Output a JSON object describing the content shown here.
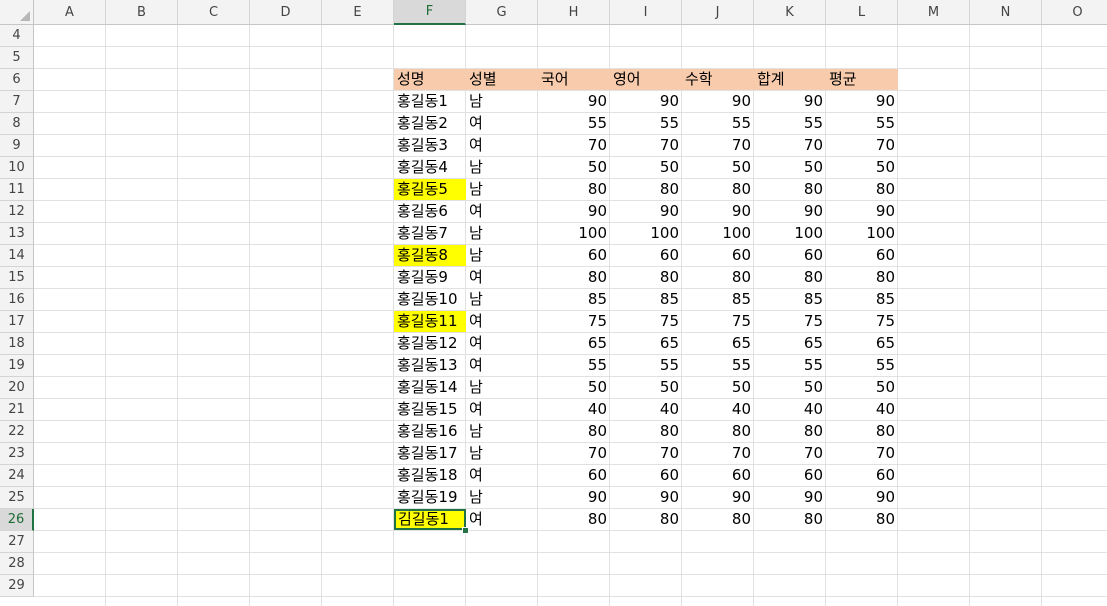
{
  "sheet": {
    "columns": [
      "A",
      "B",
      "C",
      "D",
      "E",
      "F",
      "G",
      "H",
      "I",
      "J",
      "K",
      "L",
      "M",
      "N",
      "O"
    ],
    "active_column": "F",
    "rows": [
      4,
      5,
      6,
      7,
      8,
      9,
      10,
      11,
      12,
      13,
      14,
      15,
      16,
      17,
      18,
      19,
      20,
      21,
      22,
      23,
      24,
      25,
      26,
      27,
      28,
      29
    ],
    "active_row": 26,
    "header_fill_color": "#f8cbad",
    "highlight_color": "#ffff00",
    "selection_color": "#217346"
  },
  "table": {
    "headers": [
      "성명",
      "성별",
      "국어",
      "영어",
      "수학",
      "합계",
      "평균"
    ],
    "records": [
      {
        "name": "홍길동1",
        "gender": "남",
        "kor": "90",
        "eng": "90",
        "math": "90",
        "total": "90",
        "avg": "90",
        "highlight": false
      },
      {
        "name": "홍길동2",
        "gender": "여",
        "kor": "55",
        "eng": "55",
        "math": "55",
        "total": "55",
        "avg": "55",
        "highlight": false
      },
      {
        "name": "홍길동3",
        "gender": "여",
        "kor": "70",
        "eng": "70",
        "math": "70",
        "total": "70",
        "avg": "70",
        "highlight": false
      },
      {
        "name": "홍길동4",
        "gender": "남",
        "kor": "50",
        "eng": "50",
        "math": "50",
        "total": "50",
        "avg": "50",
        "highlight": false
      },
      {
        "name": "홍길동5",
        "gender": "남",
        "kor": "80",
        "eng": "80",
        "math": "80",
        "total": "80",
        "avg": "80",
        "highlight": true
      },
      {
        "name": "홍길동6",
        "gender": "여",
        "kor": "90",
        "eng": "90",
        "math": "90",
        "total": "90",
        "avg": "90",
        "highlight": false
      },
      {
        "name": "홍길동7",
        "gender": "남",
        "kor": "100",
        "eng": "100",
        "math": "100",
        "total": "100",
        "avg": "100",
        "highlight": false
      },
      {
        "name": "홍길동8",
        "gender": "남",
        "kor": "60",
        "eng": "60",
        "math": "60",
        "total": "60",
        "avg": "60",
        "highlight": true
      },
      {
        "name": "홍길동9",
        "gender": "여",
        "kor": "80",
        "eng": "80",
        "math": "80",
        "total": "80",
        "avg": "80",
        "highlight": false
      },
      {
        "name": "홍길동10",
        "gender": "남",
        "kor": "85",
        "eng": "85",
        "math": "85",
        "total": "85",
        "avg": "85",
        "highlight": false
      },
      {
        "name": "홍길동11",
        "gender": "여",
        "kor": "75",
        "eng": "75",
        "math": "75",
        "total": "75",
        "avg": "75",
        "highlight": true
      },
      {
        "name": "홍길동12",
        "gender": "여",
        "kor": "65",
        "eng": "65",
        "math": "65",
        "total": "65",
        "avg": "65",
        "highlight": false
      },
      {
        "name": "홍길동13",
        "gender": "여",
        "kor": "55",
        "eng": "55",
        "math": "55",
        "total": "55",
        "avg": "55",
        "highlight": false
      },
      {
        "name": "홍길동14",
        "gender": "남",
        "kor": "50",
        "eng": "50",
        "math": "50",
        "total": "50",
        "avg": "50",
        "highlight": false
      },
      {
        "name": "홍길동15",
        "gender": "여",
        "kor": "40",
        "eng": "40",
        "math": "40",
        "total": "40",
        "avg": "40",
        "highlight": false
      },
      {
        "name": "홍길동16",
        "gender": "남",
        "kor": "80",
        "eng": "80",
        "math": "80",
        "total": "80",
        "avg": "80",
        "highlight": false
      },
      {
        "name": "홍길동17",
        "gender": "남",
        "kor": "70",
        "eng": "70",
        "math": "70",
        "total": "70",
        "avg": "70",
        "highlight": false
      },
      {
        "name": "홍길동18",
        "gender": "여",
        "kor": "60",
        "eng": "60",
        "math": "60",
        "total": "60",
        "avg": "60",
        "highlight": false
      },
      {
        "name": "홍길동19",
        "gender": "남",
        "kor": "90",
        "eng": "90",
        "math": "90",
        "total": "90",
        "avg": "90",
        "highlight": false
      },
      {
        "name": "김길동1",
        "gender": "여",
        "kor": "80",
        "eng": "80",
        "math": "80",
        "total": "80",
        "avg": "80",
        "highlight": true,
        "selected": true
      }
    ]
  }
}
